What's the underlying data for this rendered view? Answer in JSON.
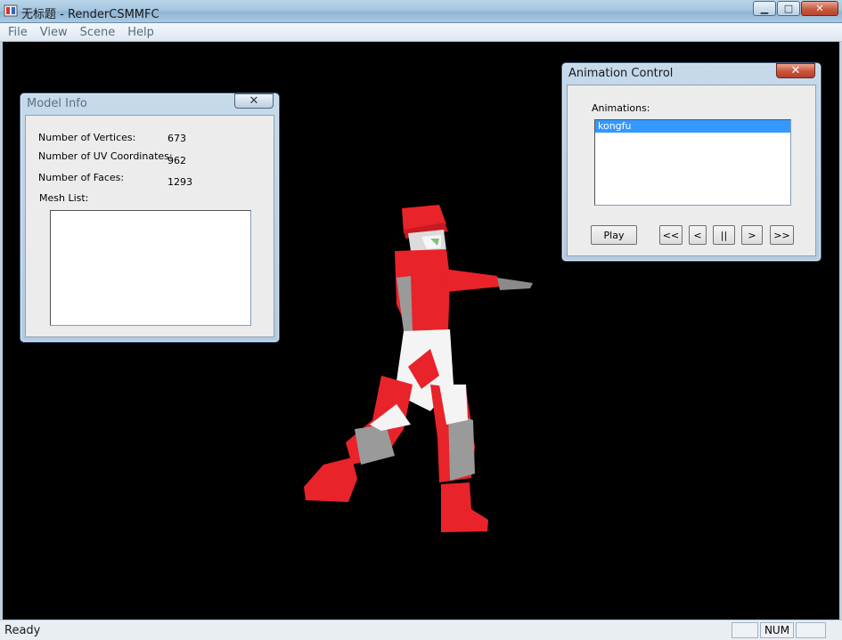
{
  "window": {
    "title": "无标题 - RenderCSMMFC",
    "minimize": "▁",
    "maximize": "□",
    "close": "✕"
  },
  "menu": {
    "items": [
      "File",
      "View",
      "Scene",
      "Help"
    ]
  },
  "model_info": {
    "title": "Model Info",
    "close": "✕",
    "vertices_label": "Number of Vertices:",
    "vertices_value": "673",
    "uv_label": "Number of UV Coordinates:",
    "uv_value": "962",
    "faces_label": "Number of Faces:",
    "faces_value": "1293",
    "mesh_list_label": "Mesh List:",
    "mesh_list": []
  },
  "animation_control": {
    "title": "Animation Control",
    "close": "✕",
    "animations_label": "Animations:",
    "animations": [
      "kongfu"
    ],
    "selected": "kongfu",
    "buttons": {
      "play": "Play",
      "first": "<<",
      "prev": "<",
      "pause": "||",
      "next": ">",
      "last": ">>"
    }
  },
  "status": {
    "text": "Ready",
    "num": "NUM"
  },
  "colors": {
    "viewport_bg": "#000000",
    "figure_red": "#e8232a",
    "figure_white": "#f4f4f4",
    "figure_gray": "#9a9a9a",
    "selection": "#3399ff"
  }
}
